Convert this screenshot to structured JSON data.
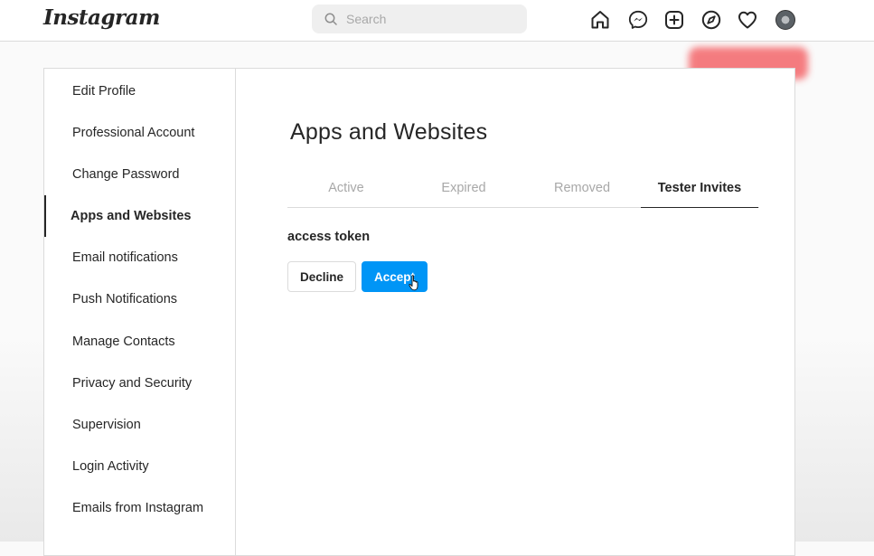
{
  "header": {
    "logo": "Instagram",
    "search_placeholder": "Search",
    "icons": [
      "home-icon",
      "messenger-icon",
      "new-post-icon",
      "explore-icon",
      "activity-heart-icon",
      "profile-avatar"
    ]
  },
  "sidebar": {
    "items": [
      {
        "label": "Edit Profile"
      },
      {
        "label": "Professional Account"
      },
      {
        "label": "Change Password"
      },
      {
        "label": "Apps and Websites"
      },
      {
        "label": "Email notifications"
      },
      {
        "label": "Push Notifications"
      },
      {
        "label": "Manage Contacts"
      },
      {
        "label": "Privacy and Security"
      },
      {
        "label": "Supervision"
      },
      {
        "label": "Login Activity"
      },
      {
        "label": "Emails from Instagram"
      }
    ],
    "active_item": "Apps and Websites"
  },
  "main": {
    "title": "Apps and Websites",
    "tabs": [
      {
        "label": "Active"
      },
      {
        "label": "Expired"
      },
      {
        "label": "Removed"
      },
      {
        "label": "Tester Invites"
      }
    ],
    "active_tab": "Tester Invites",
    "invite": {
      "name": "access token",
      "decline_label": "Decline",
      "accept_label": "Accept"
    }
  },
  "colors": {
    "accent": "#0095f6",
    "border": "#dbdbdb",
    "text": "#262626",
    "muted": "#a8a8a8"
  }
}
